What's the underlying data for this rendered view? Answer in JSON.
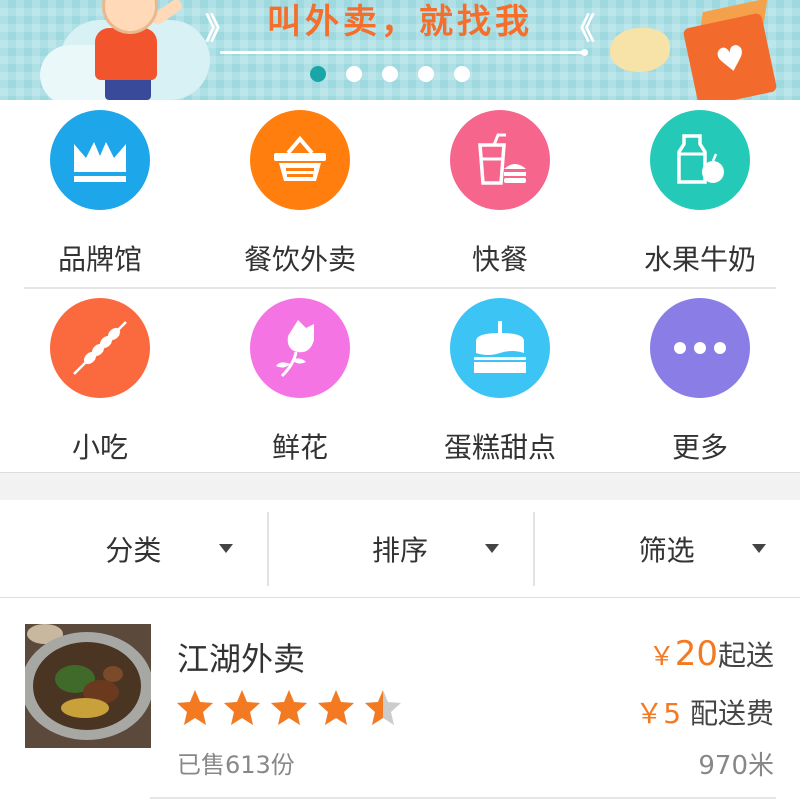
{
  "banner": {
    "slogan": "叫外卖，就找我",
    "chevron_left": "》",
    "chevron_right": "《",
    "active_slide": 1,
    "slide_count": 5
  },
  "categories": [
    {
      "label": "品牌馆",
      "icon": "crown-icon",
      "color": "#1ea6ea"
    },
    {
      "label": "餐饮外卖",
      "icon": "basket-icon",
      "color": "#ff7e0d"
    },
    {
      "label": "快餐",
      "icon": "fastfood-icon",
      "color": "#f6658c"
    },
    {
      "label": "水果牛奶",
      "icon": "milk-apple-icon",
      "color": "#25c9b8"
    },
    {
      "label": "小吃",
      "icon": "skewer-icon",
      "color": "#fb6a3f"
    },
    {
      "label": "鲜花",
      "icon": "rose-icon",
      "color": "#f574e4"
    },
    {
      "label": "蛋糕甜点",
      "icon": "cake-icon",
      "color": "#3bc4f4"
    },
    {
      "label": "更多",
      "icon": "more-icon",
      "color": "#8a7ee6"
    }
  ],
  "filters": [
    {
      "label": "分类"
    },
    {
      "label": "排序"
    },
    {
      "label": "筛选"
    }
  ],
  "store": {
    "name": "江湖外卖",
    "rating": 4.5,
    "rating_max": 5,
    "sold": "已售613份",
    "min_order_symbol": "￥",
    "min_order_amount": "20",
    "min_order_suffix": "起送",
    "fee_price": "￥5",
    "fee_label": "配送费",
    "distance": "970米",
    "accent_color": "#f47a22",
    "star_color": "#f47a22",
    "star_empty_color": "#cccccc"
  }
}
